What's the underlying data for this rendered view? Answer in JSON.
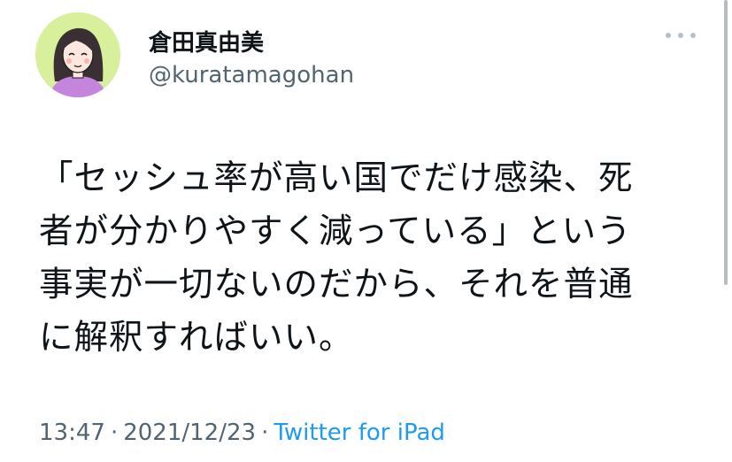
{
  "author": {
    "display_name": "倉田真由美",
    "handle": "@kuratamagohan",
    "avatar_icon": "cartoon-woman-avatar",
    "avatar_bg": "#d8ef9c"
  },
  "tweet": {
    "text": "「セッシュ率が高い国でだけ感染、死\n者が分かりやすく減っている」という\n事実が一切ないのだから、それを普通\nに解釈すればいい。",
    "time": "13:47",
    "separator": "·",
    "date": "2021/12/23",
    "source": "Twitter for iPad"
  },
  "ui": {
    "more_icon": "more-dots-icon"
  },
  "colors": {
    "text_primary": "#0f1419",
    "text_secondary": "#536471",
    "link": "#1d9bf0"
  }
}
